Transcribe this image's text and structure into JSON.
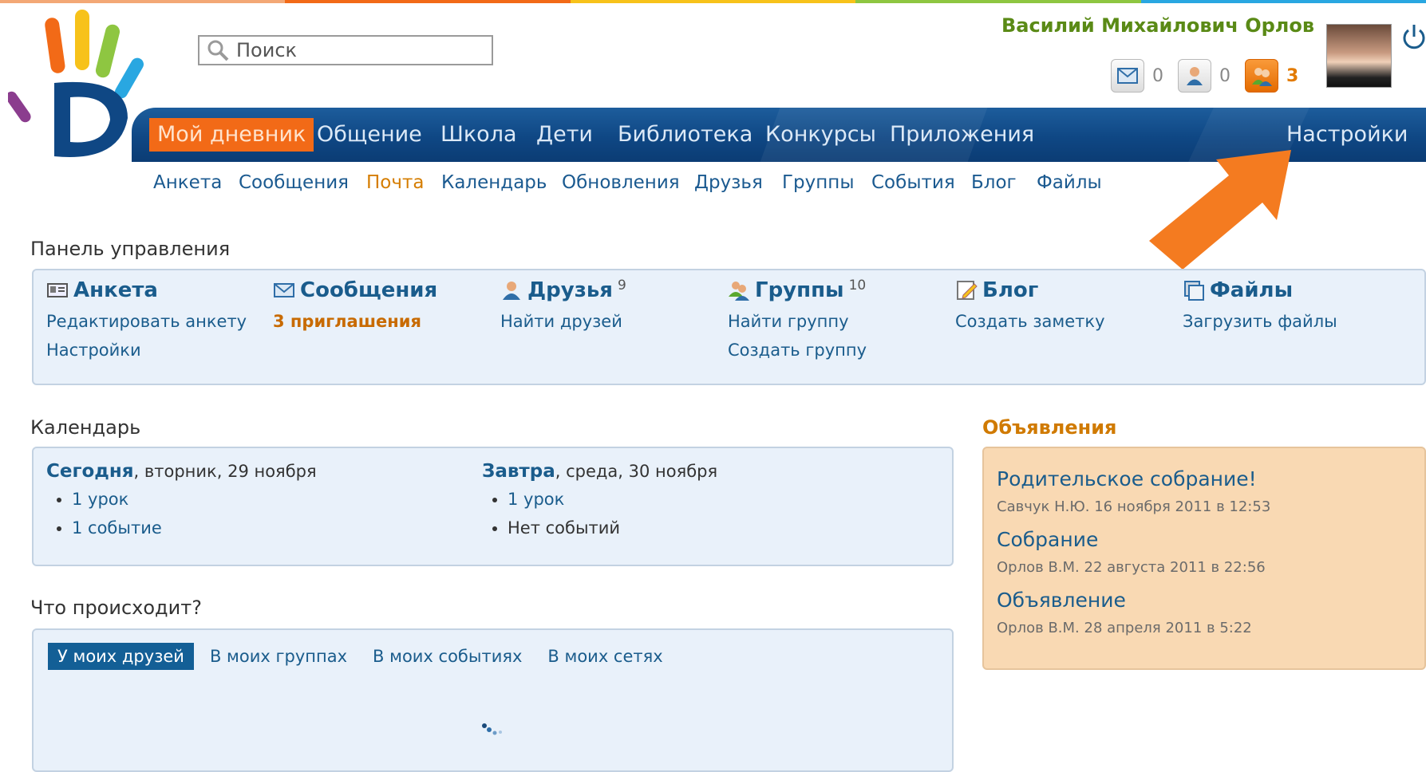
{
  "brand": {
    "strip_colors": [
      "#f3a876",
      "#f26a17",
      "#f7c21a",
      "#8ec641",
      "#29a7e1"
    ],
    "accent": "#f26a17",
    "nav_bg": "#0f4784"
  },
  "search": {
    "placeholder": "Поиск"
  },
  "user": {
    "name": "Василий Михайлович Орлов",
    "avatar_icon": "user-photo",
    "power_icon": "power-icon",
    "counters": [
      {
        "icon": "envelope-icon",
        "value": "0"
      },
      {
        "icon": "person-icon",
        "value": "0"
      },
      {
        "icon": "friends-icon",
        "value": "3"
      }
    ]
  },
  "main_nav": {
    "items": [
      "Мой дневник",
      "Общение",
      "Школа",
      "Дети",
      "Библиотека",
      "Конкурсы",
      "Приложения"
    ],
    "settings": "Настройки"
  },
  "sub_nav": {
    "items": [
      "Анкета",
      "Сообщения",
      "Почта",
      "Календарь",
      "Обновления",
      "Друзья",
      "Группы",
      "События",
      "Блог",
      "Файлы"
    ],
    "active": "Почта"
  },
  "control_panel": {
    "title": "Панель управления",
    "columns": [
      {
        "title": "Анкета",
        "links": [
          "Редактировать анкету",
          "Настройки"
        ]
      },
      {
        "title": "Сообщения",
        "links": [
          "3 приглашения"
        ]
      },
      {
        "title": "Друзья",
        "count": "9",
        "links": [
          "Найти друзей"
        ]
      },
      {
        "title": "Группы",
        "count": "10",
        "links": [
          "Найти группу",
          "Создать группу"
        ]
      },
      {
        "title": "Блог",
        "links": [
          "Создать заметку"
        ]
      },
      {
        "title": "Файлы",
        "links": [
          "Загрузить файлы"
        ]
      }
    ]
  },
  "calendar": {
    "title": "Календарь",
    "today": {
      "label": "Сегодня",
      "date": ", вторник, 29 ноября",
      "items": [
        "1 урок",
        "1 событие"
      ]
    },
    "tomorrow": {
      "label": "Завтра",
      "date": ", среда, 30 ноября",
      "items": [
        "1 урок",
        "Нет событий"
      ]
    }
  },
  "whats_up": {
    "title": "Что происходит?",
    "tabs": [
      "У моих друзей",
      "В моих группах",
      "В моих событиях",
      "В моих сетях"
    ]
  },
  "ads": {
    "title": "Объявления",
    "items": [
      {
        "title": "Родительское собрание!",
        "meta": "Савчук Н.Ю. 16 ноября 2011 в 12:53"
      },
      {
        "title": "Собрание",
        "meta": "Орлов В.М. 22 августа 2011 в 22:56"
      },
      {
        "title": "Объявление",
        "meta": "Орлов В.М. 28 апреля 2011 в 5:22"
      }
    ]
  }
}
